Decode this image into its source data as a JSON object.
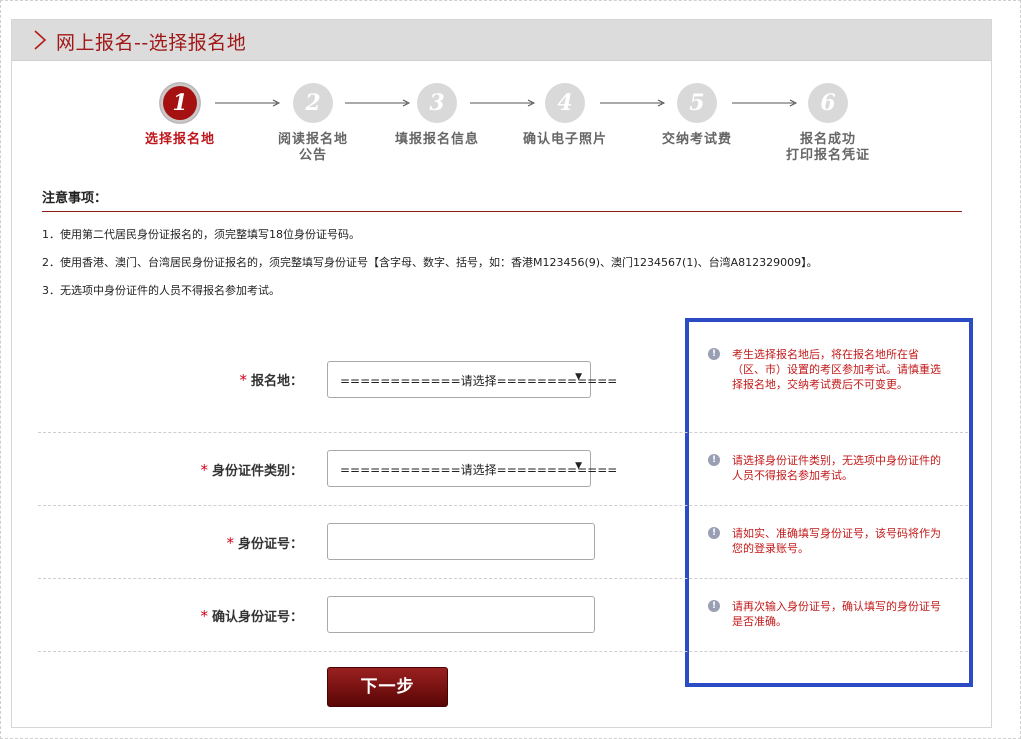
{
  "header": {
    "title": "网上报名--选择报名地"
  },
  "steps": [
    {
      "num": "1",
      "label": "选择报名地",
      "active": true
    },
    {
      "num": "2",
      "label_line1": "阅读报名地",
      "label_line2": "公告"
    },
    {
      "num": "3",
      "label": "填报报名信息"
    },
    {
      "num": "4",
      "label": "确认电子照片"
    },
    {
      "num": "5",
      "label": "交纳考试费"
    },
    {
      "num": "6",
      "label_line1": "报名成功",
      "label_line2": "打印报名凭证"
    }
  ],
  "notice": {
    "title": "注意事项：",
    "items": [
      "1．使用第二代居民身份证报名的，须完整填写18位身份证号码。",
      "2．使用香港、澳门、台湾居民身份证报名的，须完整填写身份证号【含字母、数字、括号，如：香港M123456(9)、澳门1234567(1)、台湾A812329009】。",
      "3．无选项中身份证件的人员不得报名参加考试。"
    ]
  },
  "form": {
    "required_mark": "*",
    "fields": [
      {
        "label": "报名地：",
        "value": "============请选择============",
        "help": "考生选择报名地后，将在报名地所在省（区、市）设置的考区参加考试。请慎重选择报名地，交纳考试费后不可变更。"
      },
      {
        "label": "身份证件类别：",
        "value": "============请选择============",
        "help": "请选择身份证件类别，无选项中身份证件的人员不得报名参加考试。"
      },
      {
        "label": "身份证号：",
        "value": "",
        "help": "请如实、准确填写身份证号，该号码将作为您的登录账号。"
      },
      {
        "label": "确认身份证号：",
        "value": "",
        "help": "请再次输入身份证号，确认填写的身份证号是否准确。"
      }
    ],
    "next_label": "下一步"
  },
  "icons": {
    "header": "chevron-right-icon",
    "help": "info-icon",
    "select": "caret-down-icon"
  },
  "colors": {
    "accent": "#a51010",
    "highlight_border": "#2b4cc4",
    "help_text": "#c21a1a"
  }
}
